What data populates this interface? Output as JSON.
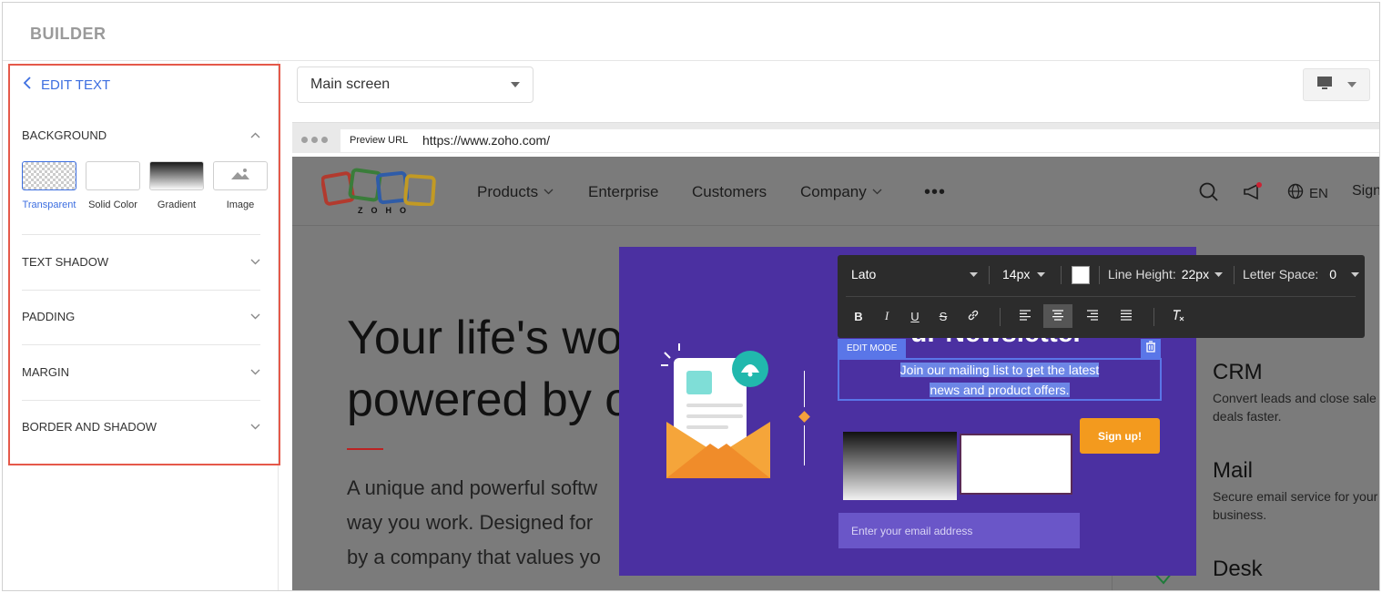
{
  "app": {
    "title": "BUILDER"
  },
  "panel": {
    "back_label": "EDIT TEXT",
    "sections": {
      "background": "BACKGROUND",
      "text_shadow": "TEXT SHADOW",
      "padding": "PADDING",
      "margin": "MARGIN",
      "border_shadow": "BORDER AND SHADOW"
    },
    "background_options": [
      "Transparent",
      "Solid Color",
      "Gradient",
      "Image"
    ],
    "selected_background": "Transparent"
  },
  "screen_select": {
    "value": "Main screen"
  },
  "preview": {
    "url_label": "Preview URL",
    "url": "https://www.zoho.com/",
    "logo_text": "ZOHO",
    "nav": [
      "Products",
      "Enterprise",
      "Customers",
      "Company"
    ],
    "more": "•••",
    "lang": "EN",
    "sign": "Sign",
    "hero_title": "Your life's wo\npowered by o",
    "hero_sub": "A unique and powerful softw\nway you work. Designed for\nby a company that values yo",
    "products": [
      {
        "name": "CRM",
        "desc": "Convert leads and close sale\ndeals faster."
      },
      {
        "name": "Mail",
        "desc": "Secure email service for your\nbusiness."
      },
      {
        "name": "Desk",
        "desc": ""
      }
    ]
  },
  "modal": {
    "heading_partial": "ur Newsletter",
    "edit_mode_label": "EDIT MODE",
    "text_line1": "Join our mailing list to get the latest",
    "text_line2": "news and product offers.",
    "signup_label": "Sign up!",
    "email_placeholder": "Enter your email address"
  },
  "toolbar": {
    "font": "Lato",
    "size": "14px",
    "text_color": "#ffffff",
    "line_height_label": "Line Height:",
    "line_height": "22px",
    "letter_space_label": "Letter Space:",
    "letter_space": "0",
    "format_buttons": [
      "B",
      "I",
      "U",
      "S"
    ],
    "active_align": "center"
  },
  "colors": {
    "accent": "#3c6ee0",
    "highlight": "#e5594a",
    "modal_bg": "#4b30a1",
    "signup": "#f39a1e",
    "edit_blue": "#5a76e8"
  }
}
